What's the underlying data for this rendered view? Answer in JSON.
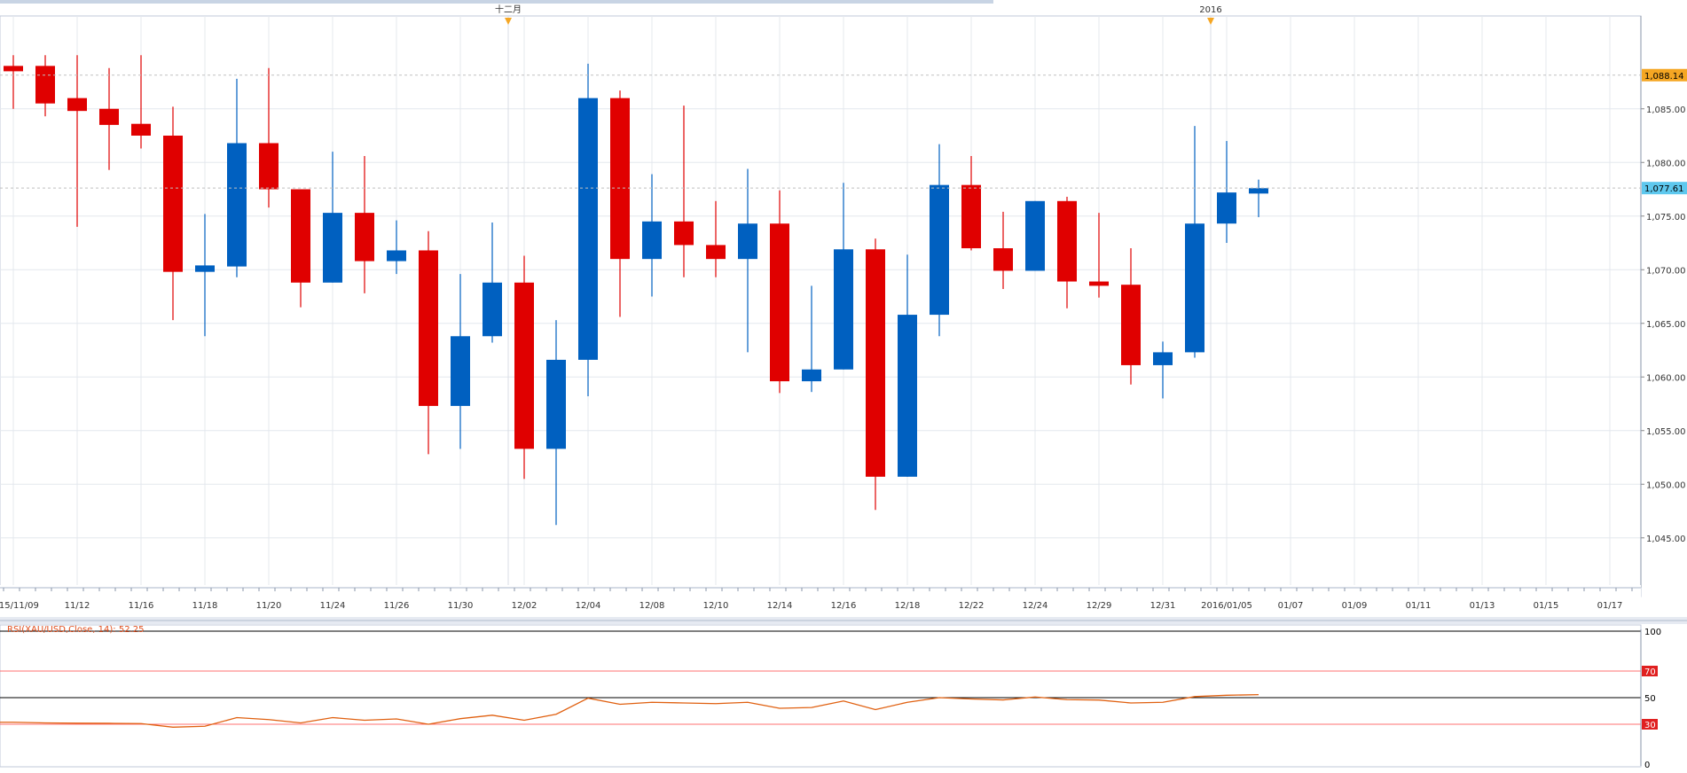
{
  "chart_data": [
    {
      "type": "candlestick",
      "ylim": [
        1042.5,
        1092.5
      ],
      "y_ticks": [
        1045,
        1050,
        1055,
        1060,
        1065,
        1070,
        1075,
        1080,
        1085
      ],
      "y_tick_labels": [
        "1,045.00",
        "1,050.00",
        "1,055.00",
        "1,060.00",
        "1,065.00",
        "1,070.00",
        "1,075.00",
        "1,080.00",
        "1,085.00"
      ],
      "current_price_labels": [
        {
          "value": 1088.14,
          "text": "1,088.14",
          "color": "#f5a623"
        },
        {
          "value": 1077.61,
          "text": "1,077.61",
          "color": "#5ec8ee"
        }
      ],
      "date_labels": [
        "2015/11/09",
        "11/12",
        "11/16",
        "11/18",
        "11/20",
        "11/24",
        "11/26",
        "11/30",
        "12/02",
        "12/04",
        "12/08",
        "12/10",
        "12/14",
        "12/16",
        "12/18",
        "12/22",
        "12/24",
        "12/29",
        "12/31",
        "2016/01/05",
        "01/07",
        "01/09",
        "01/11",
        "01/13",
        "01/15",
        "01/17"
      ],
      "event_markers": [
        {
          "label": "十二月",
          "slot": 15
        },
        {
          "label": "2016",
          "slot": 37
        }
      ],
      "up_color": "#0060c0",
      "down_color": "#e00000",
      "candles": [
        {
          "o": 1089.0,
          "h": 1090.0,
          "l": 1085.0,
          "c": 1088.5
        },
        {
          "o": 1089.0,
          "h": 1090.0,
          "l": 1084.3,
          "c": 1085.5
        },
        {
          "o": 1086.0,
          "h": 1090.0,
          "l": 1074.0,
          "c": 1084.8
        },
        {
          "o": 1085.0,
          "h": 1088.8,
          "l": 1079.3,
          "c": 1083.5
        },
        {
          "o": 1083.6,
          "h": 1090.0,
          "l": 1081.3,
          "c": 1082.5
        },
        {
          "o": 1082.5,
          "h": 1085.2,
          "l": 1065.3,
          "c": 1069.8
        },
        {
          "o": 1069.8,
          "h": 1075.2,
          "l": 1063.8,
          "c": 1070.4
        },
        {
          "o": 1070.3,
          "h": 1087.8,
          "l": 1069.3,
          "c": 1081.8
        },
        {
          "o": 1081.8,
          "h": 1088.8,
          "l": 1075.8,
          "c": 1077.5
        },
        {
          "o": 1077.5,
          "h": 1077.5,
          "l": 1066.5,
          "c": 1068.8
        },
        {
          "o": 1068.8,
          "h": 1081.0,
          "l": 1068.8,
          "c": 1075.3
        },
        {
          "o": 1075.3,
          "h": 1080.6,
          "l": 1067.8,
          "c": 1070.8
        },
        {
          "o": 1070.8,
          "h": 1074.6,
          "l": 1069.6,
          "c": 1071.8
        },
        {
          "o": 1071.8,
          "h": 1073.6,
          "l": 1052.8,
          "c": 1057.3
        },
        {
          "o": 1057.3,
          "h": 1069.6,
          "l": 1053.3,
          "c": 1063.8
        },
        {
          "o": 1063.8,
          "h": 1074.4,
          "l": 1063.2,
          "c": 1068.8
        },
        {
          "o": 1068.8,
          "h": 1071.3,
          "l": 1050.5,
          "c": 1053.3
        },
        {
          "o": 1053.3,
          "h": 1065.3,
          "l": 1046.2,
          "c": 1061.6
        },
        {
          "o": 1061.6,
          "h": 1089.2,
          "l": 1058.2,
          "c": 1086.0
        },
        {
          "o": 1086.0,
          "h": 1086.7,
          "l": 1065.6,
          "c": 1071.0
        },
        {
          "o": 1071.0,
          "h": 1078.9,
          "l": 1067.5,
          "c": 1074.5
        },
        {
          "o": 1074.5,
          "h": 1085.3,
          "l": 1069.3,
          "c": 1072.3
        },
        {
          "o": 1072.3,
          "h": 1076.4,
          "l": 1069.3,
          "c": 1071.0
        },
        {
          "o": 1071.0,
          "h": 1079.4,
          "l": 1062.3,
          "c": 1074.3
        },
        {
          "o": 1074.3,
          "h": 1077.4,
          "l": 1058.5,
          "c": 1059.6
        },
        {
          "o": 1059.6,
          "h": 1068.5,
          "l": 1058.6,
          "c": 1060.7
        },
        {
          "o": 1060.7,
          "h": 1078.1,
          "l": 1060.7,
          "c": 1071.9
        },
        {
          "o": 1071.9,
          "h": 1072.9,
          "l": 1047.6,
          "c": 1050.7
        },
        {
          "o": 1050.7,
          "h": 1071.4,
          "l": 1050.7,
          "c": 1065.8
        },
        {
          "o": 1065.8,
          "h": 1081.7,
          "l": 1063.8,
          "c": 1077.9
        },
        {
          "o": 1077.9,
          "h": 1080.6,
          "l": 1071.8,
          "c": 1072.0
        },
        {
          "o": 1072.0,
          "h": 1075.4,
          "l": 1068.2,
          "c": 1069.9
        },
        {
          "o": 1069.9,
          "h": 1076.4,
          "l": 1069.9,
          "c": 1076.4
        },
        {
          "o": 1076.4,
          "h": 1076.8,
          "l": 1066.4,
          "c": 1068.9
        },
        {
          "o": 1068.9,
          "h": 1075.3,
          "l": 1067.4,
          "c": 1068.5
        },
        {
          "o": 1068.6,
          "h": 1072.0,
          "l": 1059.3,
          "c": 1061.1
        },
        {
          "o": 1061.1,
          "h": 1063.3,
          "l": 1058.0,
          "c": 1062.3
        },
        {
          "o": 1062.3,
          "h": 1083.4,
          "l": 1061.8,
          "c": 1074.3
        },
        {
          "o": 1074.3,
          "h": 1082.0,
          "l": 1072.5,
          "c": 1077.2
        },
        {
          "o": 1077.1,
          "h": 1078.4,
          "l": 1074.9,
          "c": 1077.6
        }
      ]
    },
    {
      "type": "line",
      "title": "RSI(XAU/USD,Close, 14): 52.25",
      "ylim": [
        0,
        100
      ],
      "y_ticks": [
        100,
        70,
        50,
        30,
        0
      ],
      "y_tick_labels": [
        "100",
        "70",
        "50",
        "30",
        "0"
      ],
      "levels": [
        70,
        30
      ],
      "midline": 50,
      "line_color": "#e06010",
      "values": [
        31.5,
        31.0,
        30.8,
        30.7,
        30.5,
        27.8,
        28.5,
        35.0,
        33.5,
        31.0,
        35.0,
        33.0,
        34.0,
        30.0,
        34.2,
        36.8,
        33.0,
        37.5,
        49.6,
        45.0,
        46.5,
        46.0,
        45.5,
        46.5,
        42.0,
        42.6,
        47.5,
        41.0,
        46.5,
        50.0,
        49.0,
        48.3,
        50.5,
        48.5,
        48.2,
        46.0,
        46.5,
        50.8,
        51.8,
        52.25
      ]
    }
  ]
}
